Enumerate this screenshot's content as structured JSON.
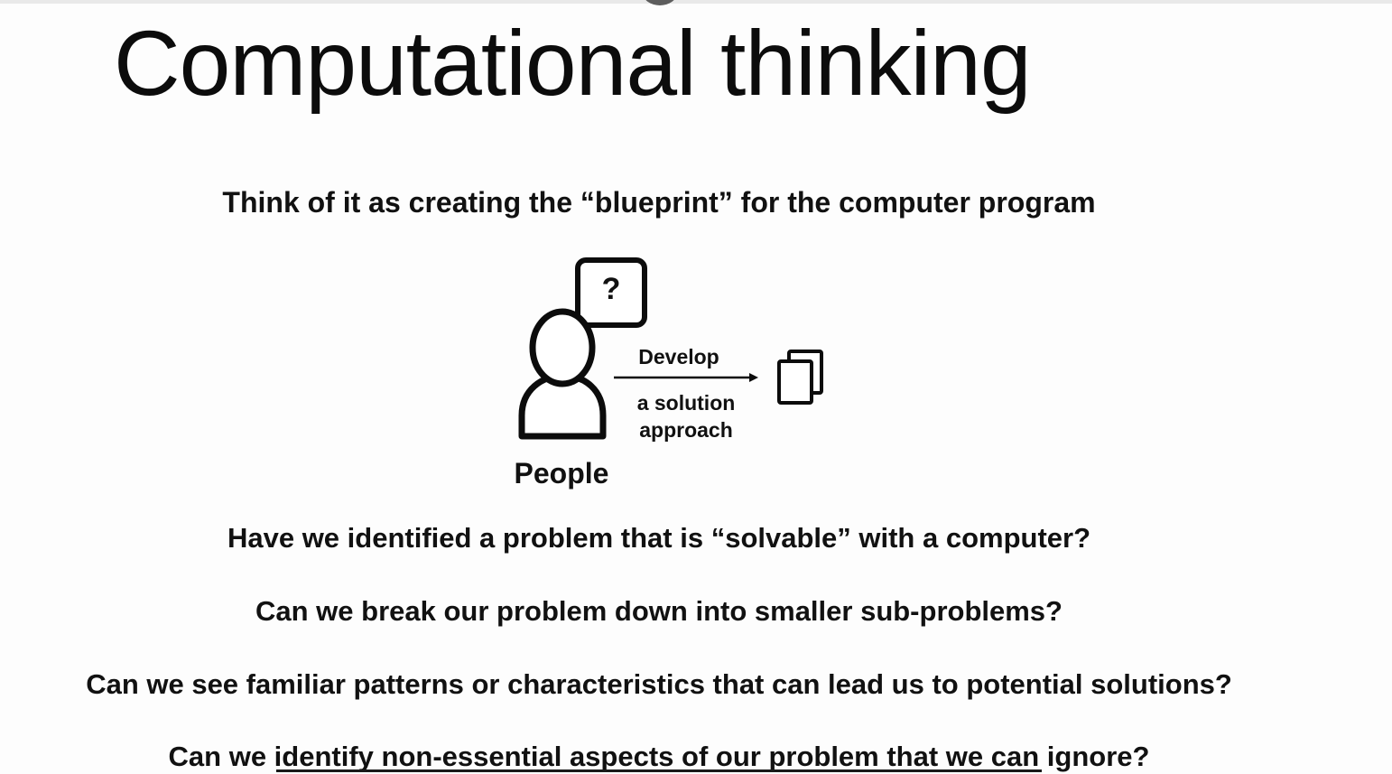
{
  "slide": {
    "title": "Computational thinking",
    "subtitle": "Think of it as creating the “blueprint” for the computer program",
    "diagram": {
      "question_mark": "?",
      "arrow_top_label": "Develop",
      "arrow_bottom_label": "a solution approach",
      "person_label": "People",
      "icons": [
        "person-icon",
        "speech-bubble-icon",
        "arrow-right-icon",
        "documents-icon"
      ]
    },
    "questions": [
      "Have we identified a problem that is “solvable” with a computer?",
      "Can we break our problem down into smaller sub-problems?",
      "Can we see familiar patterns or characteristics that can lead us to potential solutions?",
      "Can we identify non-essential aspects of our problem that we can ignore?"
    ],
    "colors": {
      "text": "#111111",
      "background": "#fdfdfd"
    }
  }
}
